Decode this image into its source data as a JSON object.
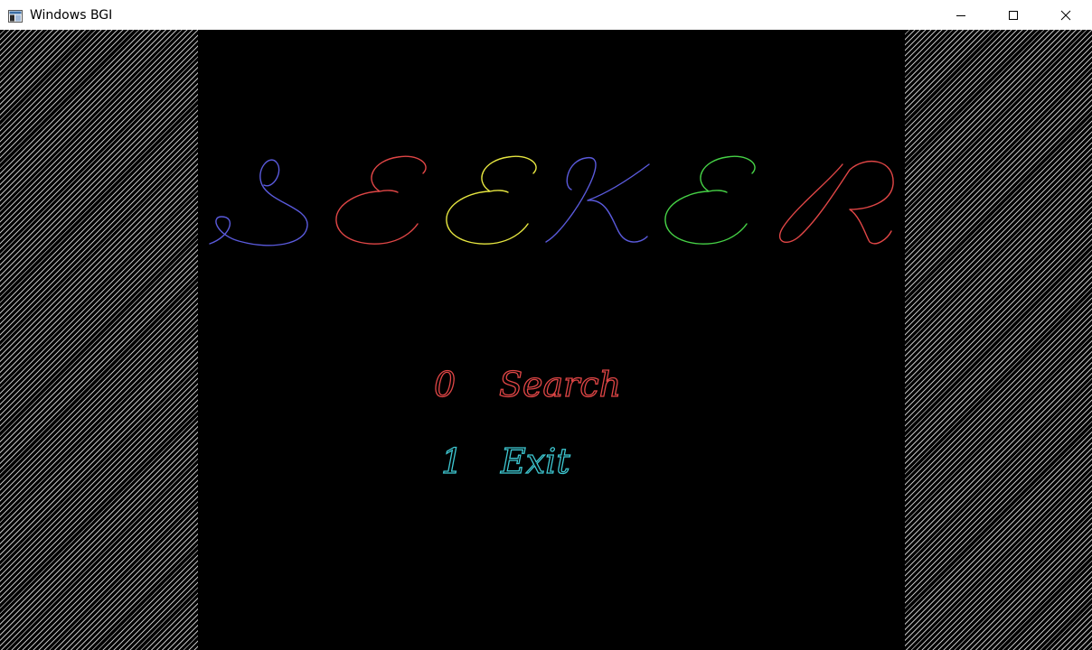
{
  "window": {
    "title": "Windows BGI",
    "controls": [
      "minimize-button",
      "maximize-button",
      "close-button"
    ]
  },
  "logo": {
    "letters": [
      {
        "char": "S",
        "color": "#5a5adc"
      },
      {
        "char": "E",
        "color": "#e04646"
      },
      {
        "char": "E",
        "color": "#e6e640"
      },
      {
        "char": "K",
        "color": "#5a5adc"
      },
      {
        "char": "E",
        "color": "#46d246"
      },
      {
        "char": "R",
        "color": "#e04646"
      }
    ]
  },
  "menu": {
    "items": [
      {
        "key": "0",
        "label": "Search",
        "color": "#e04646"
      },
      {
        "key": "1",
        "label": "Exit",
        "color": "#3ec8d2"
      }
    ]
  },
  "colors": {
    "background": "#000000",
    "hatch": "#bdbdbd",
    "titlebar": "#ffffff"
  }
}
